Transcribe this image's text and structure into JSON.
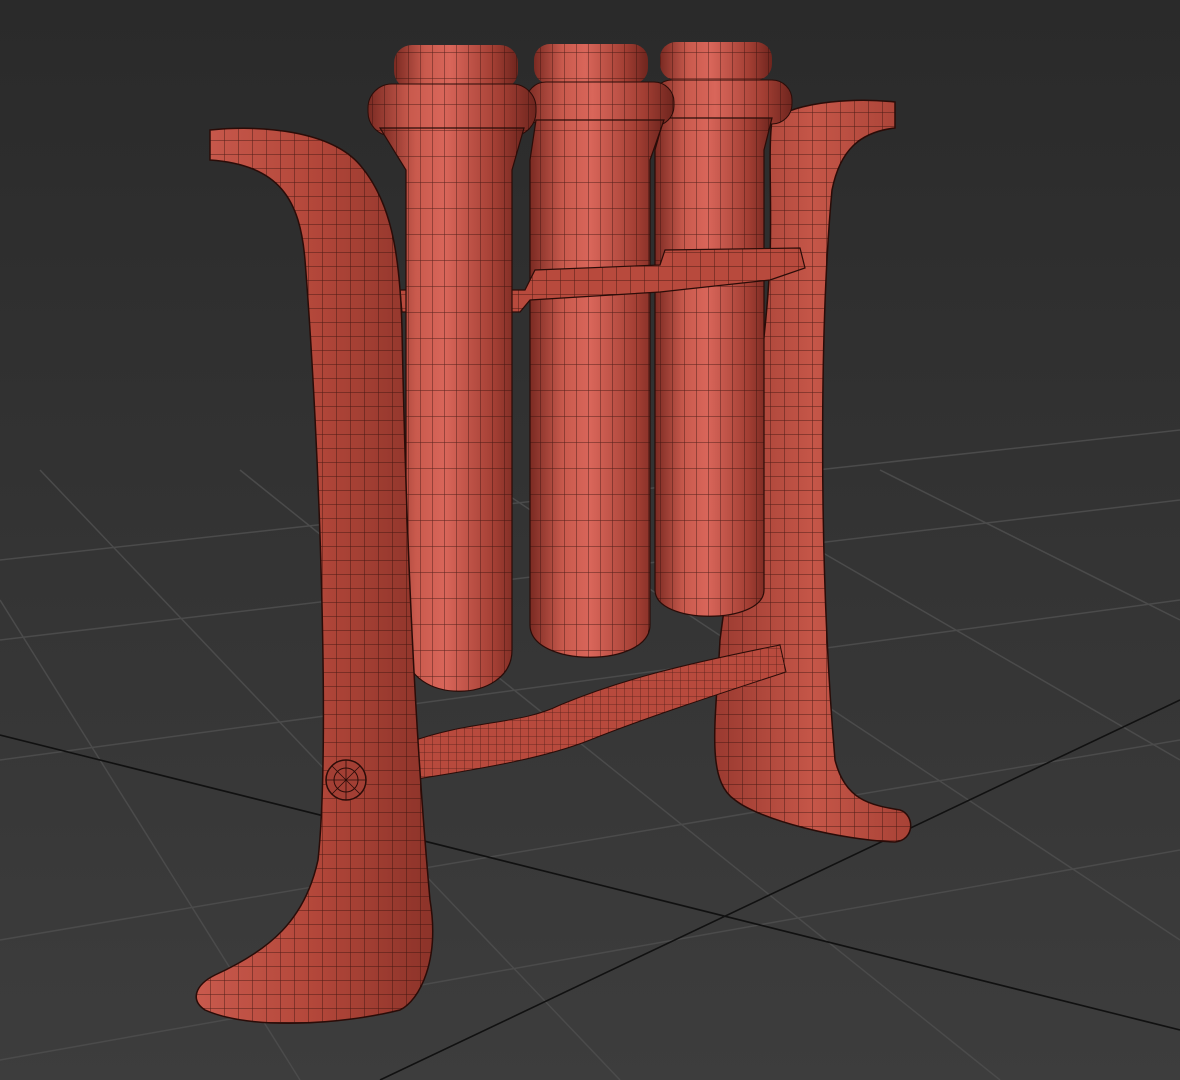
{
  "scene": {
    "object": "test-tube-rack",
    "view": "perspective",
    "display_mode": "wireframe-on-shaded",
    "colors": {
      "background_top": "#2a2a2a",
      "background_bottom": "#3c3c3c",
      "grid_line": "#4a4a4a",
      "grid_axis": "#111111",
      "model_base": "#b3473a",
      "model_light": "#d9665a",
      "model_dark": "#7a2a22",
      "wire": "#2a0c08"
    }
  }
}
